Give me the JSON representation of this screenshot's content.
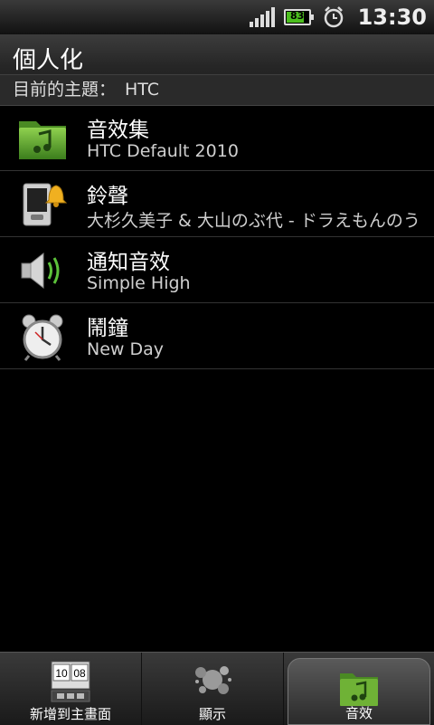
{
  "status_bar": {
    "battery_level": "83",
    "battery_fraction": 0.83,
    "time": "13:30",
    "icons": [
      "signal-icon",
      "battery-icon",
      "alarm-icon"
    ],
    "battery_color": "#4cbf1f"
  },
  "header": {
    "title": "個人化",
    "theme_label": "目前的主題：",
    "theme_value": "HTC"
  },
  "list": {
    "items": [
      {
        "title": "音效集",
        "subtitle": "HTC Default 2010",
        "icon": "sound-set-folder-icon"
      },
      {
        "title": "鈴聲",
        "subtitle": "大杉久美子 & 大山のぶ代 - ドラえもんのう",
        "icon": "ringtone-phone-icon"
      },
      {
        "title": "通知音效",
        "subtitle": "Simple High",
        "icon": "notification-speaker-icon"
      },
      {
        "title": "鬧鐘",
        "subtitle": "New Day",
        "icon": "alarm-clock-icon"
      }
    ]
  },
  "tabs": [
    {
      "label": "新增到主畫面",
      "icon": "home-widget-icon",
      "active": false,
      "clock_text": "10 08"
    },
    {
      "label": "顯示",
      "icon": "display-splash-icon",
      "active": false
    },
    {
      "label": "音效",
      "icon": "sound-folder-icon",
      "active": true
    }
  ],
  "colors": {
    "accent_green": "#5ca52a",
    "background": "#000000"
  }
}
